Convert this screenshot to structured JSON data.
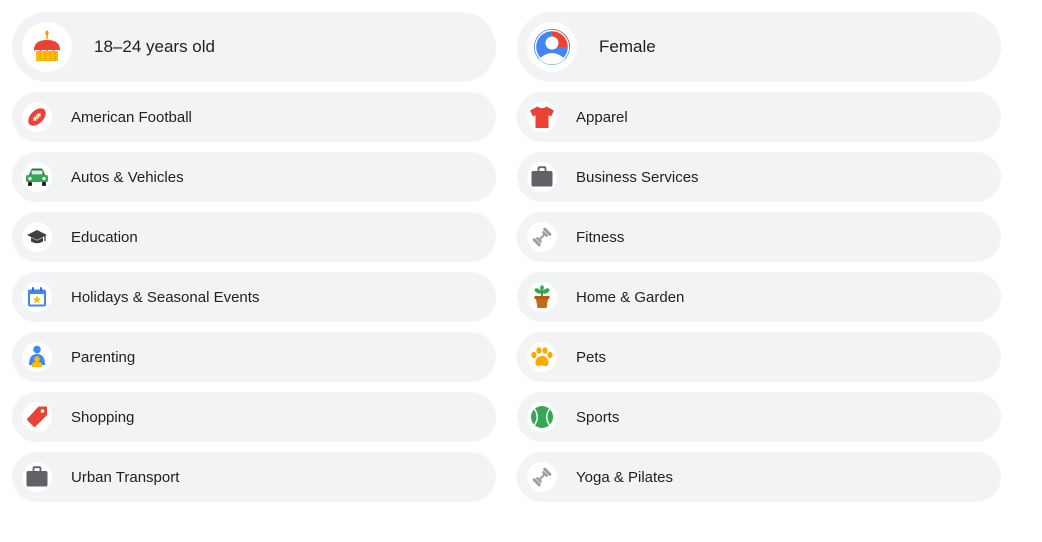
{
  "demographics": [
    {
      "label": "18–24 years old",
      "icon": "birthday-cake-icon"
    },
    {
      "label": "Female",
      "icon": "person-avatar-icon"
    }
  ],
  "interests_left": [
    {
      "label": "American Football",
      "icon": "football-icon"
    },
    {
      "label": "Autos & Vehicles",
      "icon": "car-icon"
    },
    {
      "label": "Education",
      "icon": "graduation-cap-icon"
    },
    {
      "label": "Holidays & Seasonal Events",
      "icon": "calendar-star-icon"
    },
    {
      "label": "Parenting",
      "icon": "parent-child-icon"
    },
    {
      "label": "Shopping",
      "icon": "price-tag-icon"
    },
    {
      "label": "Urban Transport",
      "icon": "briefcase-icon"
    }
  ],
  "interests_right": [
    {
      "label": "Apparel",
      "icon": "tshirt-icon"
    },
    {
      "label": "Business Services",
      "icon": "briefcase-icon"
    },
    {
      "label": "Fitness",
      "icon": "dumbbell-icon"
    },
    {
      "label": "Home & Garden",
      "icon": "potted-plant-icon"
    },
    {
      "label": "Pets",
      "icon": "paw-icon"
    },
    {
      "label": "Sports",
      "icon": "tennis-ball-icon"
    },
    {
      "label": "Yoga & Pilates",
      "icon": "dumbbell-icon"
    }
  ]
}
